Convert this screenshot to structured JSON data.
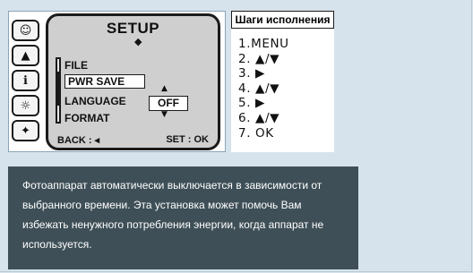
{
  "mode_icons": [
    {
      "icon": "face-scene-icon",
      "glyph": "☺"
    },
    {
      "icon": "landscape-icon",
      "glyph": "▲"
    },
    {
      "icon": "setup-tools-icon",
      "glyph": "ℹ"
    },
    {
      "icon": "sun-mode-icon",
      "glyph": "☼"
    },
    {
      "icon": "stars-scene-icon",
      "glyph": "✦"
    }
  ],
  "screen": {
    "title": "SETUP",
    "arrow_top": "◆",
    "menu_items": [
      "FILE",
      "PWR SAVE",
      "LANGUAGE",
      "FORMAT"
    ],
    "selected_index": 1,
    "option_value": "OFF",
    "option_up": "▲",
    "option_down": "▼",
    "back_hint": "BACK : ◂",
    "set_hint": "SET : OK"
  },
  "steps": {
    "title": "Шаги исполнения",
    "items": [
      "1.MENU",
      "2. ▲/▼",
      "3. ▶",
      "4. ▲/▼",
      "5. ▶",
      "6. ▲/▼",
      "7. OK"
    ]
  },
  "info": {
    "text": "Фотоаппарат автоматически выключается в зависимости от выбранного времени. Эта установка может помочь Вам избежать ненужного потребления энергии, когда аппарат не используется."
  }
}
